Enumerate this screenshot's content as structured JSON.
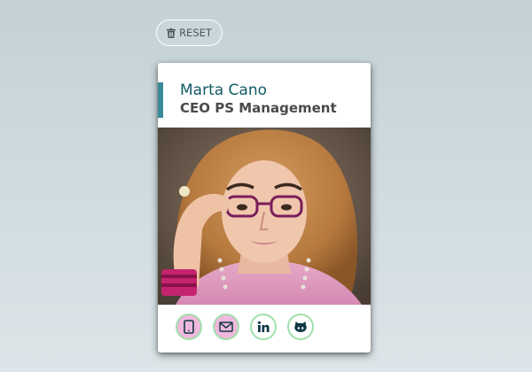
{
  "reset": {
    "label": "RESET",
    "icon": "trash-icon"
  },
  "card": {
    "name": "Marta Cano",
    "title": "CEO PS Management",
    "photo_alt": "Marta Cano"
  },
  "social": [
    {
      "name": "phone",
      "icon": "mobile-phone-icon"
    },
    {
      "name": "email",
      "icon": "envelope-icon"
    },
    {
      "name": "linkedin",
      "icon": "linkedin-icon"
    },
    {
      "name": "github",
      "icon": "github-icon"
    }
  ],
  "colors": {
    "accent": "#3a8a98",
    "name_text": "#105a64",
    "title_text": "#4a4a4a",
    "social_border": "#9fe0ad",
    "social_fill_active": "#f0b8dc",
    "social_icon": "#11384a"
  }
}
